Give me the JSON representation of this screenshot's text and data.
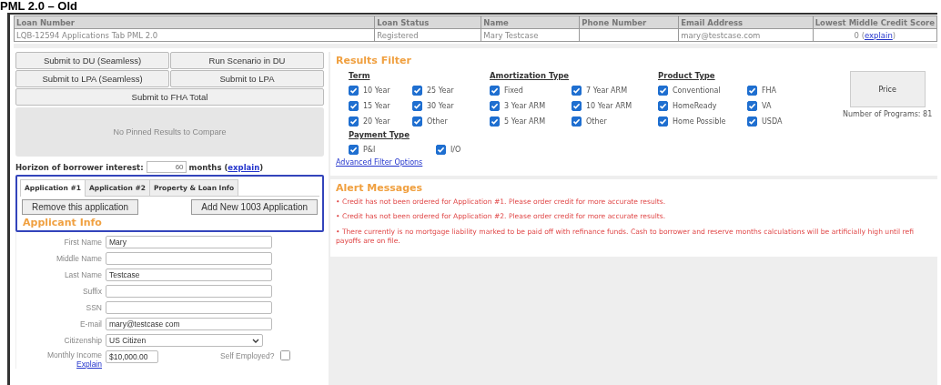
{
  "page_title": "PML 2.0 – Old",
  "loan_summary": {
    "columns": [
      "Loan Number",
      "Loan Status",
      "Name",
      "Phone Number",
      "Email Address",
      "Lowest Middle Credit Score"
    ],
    "cells": [
      {
        "text": "LQB-12594 Applications Tab PML 2.0"
      },
      {
        "text": "Registered"
      },
      {
        "text": "Mary Testcase"
      },
      {},
      {
        "text": "mary@testcase.com"
      },
      {
        "text": "0 (",
        "link": "explain",
        "after": ")"
      }
    ]
  },
  "actions": {
    "button_rows": [
      [
        "Submit to DU (Seamless)",
        "Run Scenario in DU"
      ],
      [
        "Submit to LPA (Seamless)",
        "Submit to LPA"
      ],
      [
        "Submit to FHA Total"
      ]
    ],
    "pinned_placeholder": "No Pinned Results to Compare"
  },
  "horizon": {
    "label": "Horizon of borrower interest:",
    "value": "60",
    "before_link": "months (",
    "link": "explain",
    "after_link": ")"
  },
  "application": {
    "tabs": [
      {
        "label": "Application #1",
        "selected": true
      },
      {
        "label": "Application #2",
        "selected": false
      },
      {
        "label": "Property & Loan Info",
        "selected": false
      }
    ],
    "buttons": [
      "Remove this application",
      "Add New 1003 Application"
    ],
    "section_title": "Applicant Info",
    "fields": [
      {
        "kind": "text",
        "label": "First Name",
        "value": "Mary"
      },
      {
        "kind": "text",
        "label": "Middle Name"
      },
      {
        "kind": "text",
        "label": "Last Name",
        "value": "Testcase"
      },
      {
        "kind": "text",
        "label": "Suffix"
      },
      {
        "kind": "text",
        "label": "SSN"
      },
      {
        "kind": "text",
        "label": "E-mail",
        "value": "mary@testcase com"
      },
      {
        "kind": "select",
        "label": "Citizenship",
        "value": "US Citizen"
      },
      {
        "kind": "income",
        "label": "Monthly Income",
        "value": "$10,000.00",
        "link": "Explain",
        "checkbox_label": "Self Employed?",
        "checked": false
      }
    ]
  },
  "results_filter": {
    "title": "Results Filter",
    "groups": [
      {
        "title": "Term",
        "options": [
          {
            "label": "10 Year",
            "checked": true
          },
          {
            "label": "25 Year",
            "checked": true
          },
          {
            "label": "15 Year",
            "checked": true
          },
          {
            "label": "30 Year",
            "checked": true
          },
          {
            "label": "20 Year",
            "checked": true
          },
          {
            "label": "Other",
            "checked": true
          }
        ]
      },
      {
        "title": "Amortization Type",
        "options": [
          {
            "label": "Fixed",
            "checked": true
          },
          {
            "label": "7 Year ARM",
            "checked": true
          },
          {
            "label": "3 Year ARM",
            "checked": true
          },
          {
            "label": "10 Year ARM",
            "checked": true
          },
          {
            "label": "5 Year ARM",
            "checked": true
          },
          {
            "label": "Other",
            "checked": true
          }
        ]
      },
      {
        "title": "Product Type",
        "options": [
          {
            "label": "Conventional",
            "checked": true
          },
          {
            "label": "FHA",
            "checked": true
          },
          {
            "label": "HomeReady",
            "checked": true
          },
          {
            "label": "VA",
            "checked": true
          },
          {
            "label": "Home Possible",
            "checked": true
          },
          {
            "label": "USDA",
            "checked": true
          }
        ]
      },
      {
        "title": "Payment Type",
        "options": [
          {
            "label": "P&I",
            "checked": true
          },
          {
            "label": "I/O",
            "checked": true
          }
        ]
      }
    ],
    "price_button": "Price",
    "programs_count": "Number of Programs: 81",
    "advanced_link": "Advanced Filter Options"
  },
  "alerts": {
    "title": "Alert Messages",
    "messages": [
      "• Credit has not been ordered for Application #1. Please order credit for more accurate results.",
      "• Credit has not been ordered for Application #2. Please order credit for more accurate results.",
      "• There currently is no mortgage liability marked to be paid off with refinance funds. Cash to borrower and reserve months calculations will be artificially high until refi payoffs are on file."
    ]
  }
}
